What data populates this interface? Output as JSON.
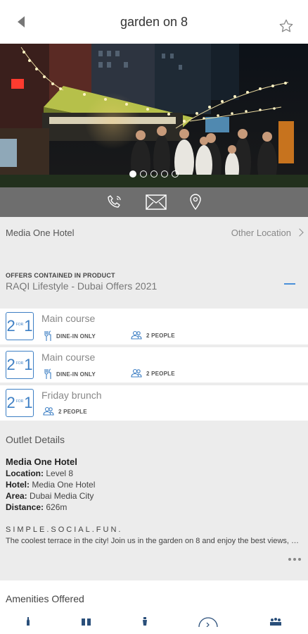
{
  "header": {
    "title": "garden on 8",
    "back_icon": "chevron-left-icon",
    "favorite_icon": "star-outline-icon"
  },
  "hero": {
    "slides": 5,
    "active_slide": 0
  },
  "actions": [
    {
      "icon": "phone-icon"
    },
    {
      "icon": "mail-icon"
    },
    {
      "icon": "map-pin-icon"
    }
  ],
  "location": {
    "name": "Media One Hotel",
    "other_label": "Other Location"
  },
  "offers": {
    "caption": "OFFERS CONTAINED IN PRODUCT",
    "product_name": "RAQI Lifestyle - Dubai Offers 2021",
    "badge": {
      "left": "2",
      "middle": "FOR",
      "right": "1"
    },
    "items": [
      {
        "title": "Main course",
        "dine_in": "DINE-IN ONLY",
        "people": "2 PEOPLE"
      },
      {
        "title": "Main course",
        "dine_in": "DINE-IN ONLY",
        "people": "2 PEOPLE"
      },
      {
        "title": "Friday brunch",
        "people": "2 PEOPLE"
      }
    ]
  },
  "outlet": {
    "heading": "Outlet Details",
    "name": "Media One Hotel",
    "location_label": "Location:",
    "location_value": "Level 8",
    "hotel_label": "Hotel:",
    "hotel_value": "Media One Hotel",
    "area_label": "Area:",
    "area_value": "Dubai Media City",
    "distance_label": "Distance:",
    "distance_value": "626m",
    "tagline": "SIMPLE.SOCIAL.FUN.",
    "description": "The coolest terrace in the city! Join us in the garden on 8 and enjoy the best views, drinks and food."
  },
  "amenities": {
    "heading": "Amenities Offered",
    "icons": [
      "bottle-icon",
      "drinks-icon",
      "shaker-icon",
      "music-icon",
      "group-icon"
    ]
  },
  "colors": {
    "accent": "#3d7fc4",
    "action_bar": "#6e6e6e",
    "page_bg": "#ececec"
  }
}
